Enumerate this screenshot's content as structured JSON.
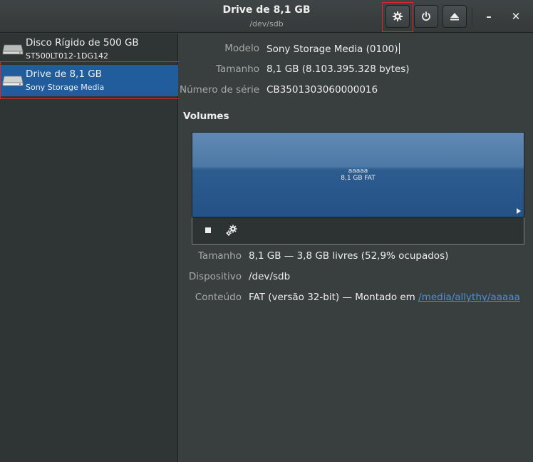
{
  "header": {
    "title": "Drive de 8,1 GB",
    "subtitle": "/dev/sdb",
    "buttons": {
      "settings_icon": "gear-icon",
      "power_icon": "power-icon",
      "eject_icon": "eject-icon",
      "minimize": "–",
      "close": "✕"
    }
  },
  "sidebar": {
    "items": [
      {
        "name": "Disco Rígido de 500 GB",
        "description": "ST500LT012-1DG142",
        "icon": "hard-disk-icon",
        "selected": false
      },
      {
        "name": "Drive de 8,1 GB",
        "description": "Sony Storage Media",
        "icon": "hard-disk-icon",
        "selected": true
      }
    ]
  },
  "drive": {
    "model_label": "Modelo",
    "model_value": "Sony Storage Media (0100)",
    "size_label": "Tamanho",
    "size_value": "8,1 GB (8.103.395.328 bytes)",
    "serial_label": "Número de série",
    "serial_value": "CB3501303060000016"
  },
  "volumes": {
    "title": "Volumes",
    "partition_name": "aaaaa",
    "partition_size": "8,1 GB FAT",
    "toolbar": {
      "stop_icon": "stop-icon",
      "options_icon": "gears-icon"
    }
  },
  "volume_details": {
    "size_label": "Tamanho",
    "size_value": "8,1 GB — 3,8 GB livres (52,9% ocupados)",
    "device_label": "Dispositivo",
    "device_value": "/dev/sdb",
    "content_label": "Conteúdo",
    "content_value": "FAT (versão 32-bit) — Montado em",
    "mount_link": "/media/allythy/aaaaa"
  },
  "colors": {
    "highlight_box": "#d9282c",
    "selection": "#215d9c",
    "link": "#4a90d9"
  }
}
